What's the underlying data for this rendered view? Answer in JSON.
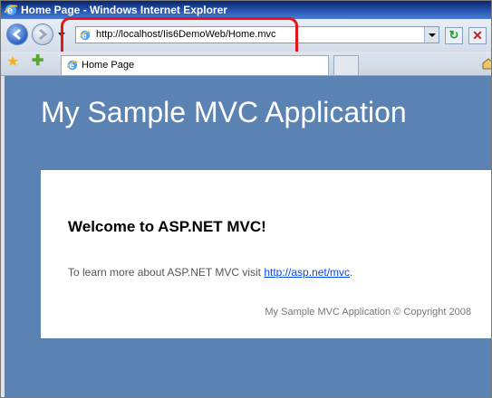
{
  "window": {
    "title": "Home Page - Windows Internet Explorer"
  },
  "address_bar": {
    "url": "http://localhost/Iis6DemoWeb/Home.mvc"
  },
  "tabs": [
    {
      "label": "Home Page"
    }
  ],
  "page": {
    "app_title": "My Sample MVC Application",
    "heading": "Welcome to ASP.NET MVC!",
    "learn_prefix": "To learn more about ASP.NET MVC visit ",
    "learn_link": "http://asp.net/mvc",
    "learn_suffix": ".",
    "footer": "My Sample MVC Application © Copyright 2008"
  },
  "colors": {
    "page_bg": "#5a83b4",
    "highlight": "#e8131b",
    "link": "#034af3"
  },
  "icons": [
    "ie-logo-icon",
    "back-arrow-icon",
    "forward-arrow-icon",
    "refresh-icon",
    "stop-icon",
    "favorites-star-icon",
    "add-favorites-icon",
    "home-icon"
  ]
}
